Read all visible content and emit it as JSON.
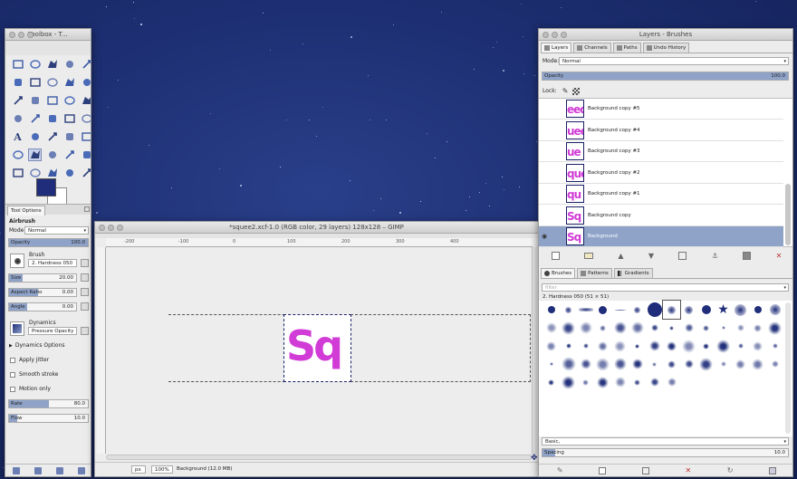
{
  "colors": {
    "fg": "#1f2d7a",
    "bg": "#ffffff",
    "text_magenta": "#d13bd6",
    "select_blue": "#8fa3c9",
    "layer_border": "#1a1f66"
  },
  "toolbox": {
    "title": "Toolbox - T...",
    "tools": [
      "rect-select",
      "ellipse-select",
      "free-select",
      "fuzzy-select",
      "color-select",
      "scissors-select",
      "foreground-select",
      "paths",
      "color-picker",
      "zoom",
      "measure",
      "move",
      "align",
      "crop",
      "rotate",
      "scale",
      "shear",
      "perspective",
      "flip",
      "cage",
      "text",
      "bucket-fill",
      "blend",
      "pencil",
      "paintbrush",
      "eraser",
      "airbrush",
      "ink",
      "clone",
      "heal",
      "smudge",
      "dodge-burn",
      "blur",
      "ink-pen",
      "my-paint"
    ]
  },
  "tool_options": {
    "tab_label": "Tool Options",
    "tool_name": "Airbrush",
    "mode_label": "Mode:",
    "mode_value": "Normal",
    "opacity_label": "Opacity",
    "opacity_value": "100.0",
    "opacity_fraction": 1.0,
    "brush_label": "Brush",
    "brush_value": "2. Hardness 050",
    "size_label": "Size",
    "size_value": "20.00",
    "size_fraction": 0.2,
    "aspect_label": "Aspect Ratio",
    "aspect_value": "0.00",
    "angle_label": "Angle",
    "angle_value": "0.00",
    "dynamics_label": "Dynamics",
    "dynamics_value": "Pressure Opacity",
    "dynamics_options": "Dynamics Options",
    "apply_jitter": "Apply Jitter",
    "smooth_stroke": "Smooth stroke",
    "motion_only": "Motion only",
    "rate_label": "Rate",
    "rate_value": "80.0",
    "rate_fraction": 0.5,
    "flow_label": "Flow",
    "flow_value": "10.0",
    "flow_fraction": 0.1
  },
  "image_window": {
    "title": "*squee2.xcf-1.0 (RGB color, 29 layers) 128x128 – GIMP",
    "ruler_ticks": [
      "-200",
      "-100",
      "0",
      "100",
      "200",
      "300",
      "400"
    ],
    "canvas_text": "Sq",
    "unit": "px",
    "zoom": "100%",
    "status": "Background (12.0 MB)"
  },
  "layers_window": {
    "title": "Layers - Brushes",
    "tabs": [
      "Layers",
      "Channels",
      "Paths",
      "Undo History"
    ],
    "mode_label": "Mode:",
    "mode_value": "Normal",
    "opacity_label": "Opacity",
    "opacity_value": "100.0",
    "lock_label": "Lock:",
    "layers": [
      {
        "name": "Background copy #5",
        "thumb": "eed"
      },
      {
        "name": "Background copy #4",
        "thumb": "uee"
      },
      {
        "name": "Background copy #3",
        "thumb": "ue"
      },
      {
        "name": "Background copy #2",
        "thumb": "que"
      },
      {
        "name": "Background copy #1",
        "thumb": "qu"
      },
      {
        "name": "Background copy",
        "thumb": "Sq"
      },
      {
        "name": "Background",
        "thumb": "Sq"
      }
    ],
    "brush_tabs": [
      "Brushes",
      "Patterns",
      "Gradients"
    ],
    "filter_placeholder": "filter",
    "brush_name": "2. Hardness 050 (51 × 51)",
    "brush_tag_value": "Basic,",
    "spacing_label": "Spacing",
    "spacing_value": "10.0",
    "spacing_fraction": 0.05
  }
}
